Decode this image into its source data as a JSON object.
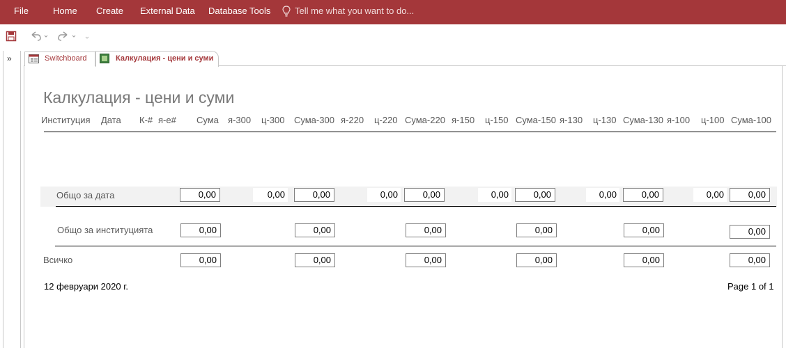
{
  "ribbon": {
    "menu": [
      "File",
      "Home",
      "Create",
      "External Data",
      "Database Tools"
    ],
    "tell_me": "Tell me what you want to do..."
  },
  "tabs": [
    {
      "label": "Switchboard"
    },
    {
      "label": "Калкулация - цени и суми"
    }
  ],
  "report": {
    "title": "Калкулация - цени и суми",
    "columns": [
      "Институция",
      "Дата",
      "К-#",
      "я-е#",
      "Сума",
      "я-300",
      "ц-300",
      "Сума-300",
      "я-220",
      "ц-220",
      "Сума-220",
      "я-150",
      "ц-150",
      "Сума-150",
      "я-130",
      "ц-130",
      "Сума-130",
      "я-100",
      "ц-100",
      "Сума-100"
    ],
    "rows": {
      "date_total": {
        "label": "Общо за дата",
        "values": [
          "0,00",
          "0,00",
          "0,00",
          "0,00",
          "0,00",
          "0,00",
          "0,00",
          "0,00",
          "0,00",
          "0,00",
          "0,00"
        ]
      },
      "inst_total": {
        "label": "Общо за институцията",
        "values": [
          "0,00",
          "0,00",
          "0,00",
          "0,00",
          "0,00",
          "0,00"
        ]
      },
      "grand_total": {
        "label": "Всичко",
        "values": [
          "0,00",
          "0,00",
          "0,00",
          "0,00",
          "0,00",
          "0,00"
        ]
      }
    },
    "footer_date": "12 февруари 2020 г.",
    "page_info": "Page 1 of 1"
  }
}
